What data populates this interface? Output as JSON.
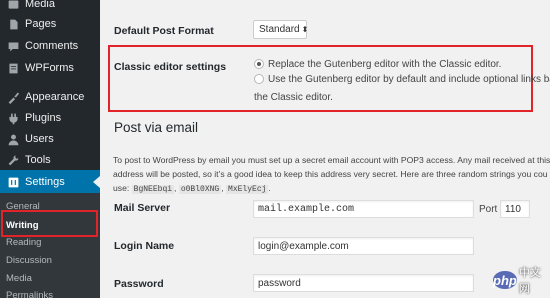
{
  "sidebar": {
    "items": [
      {
        "label": "Media",
        "icon": "media-icon"
      },
      {
        "label": "Pages",
        "icon": "pages-icon"
      },
      {
        "label": "Comments",
        "icon": "comments-icon"
      },
      {
        "label": "WPForms",
        "icon": "wpforms-icon"
      },
      {
        "label": "Appearance",
        "icon": "appearance-icon"
      },
      {
        "label": "Plugins",
        "icon": "plugins-icon"
      },
      {
        "label": "Users",
        "icon": "users-icon"
      },
      {
        "label": "Tools",
        "icon": "tools-icon"
      },
      {
        "label": "Settings",
        "icon": "settings-icon"
      }
    ],
    "submenu": [
      "General",
      "Writing",
      "Reading",
      "Discussion",
      "Media",
      "Permalinks"
    ]
  },
  "writing": {
    "default_post_format_label": "Default Post Format",
    "default_post_format_value": "Standard",
    "classic_editor_label": "Classic editor settings",
    "classic_option_1": "Replace the Gutenberg editor with the Classic editor.",
    "classic_option_2_line1": "Use the Gutenberg editor by default and include optional links back to",
    "classic_option_2_line2": "the Classic editor."
  },
  "post_via_email": {
    "heading": "Post via email",
    "desc_line1": "To post to WordPress by email you must set up a secret email account with POP3 access. Any mail received at this",
    "desc_line2": "address will be posted, so it’s a good idea to keep this address very secret. Here are three random strings you cou",
    "desc_use": "use:",
    "codes": [
      "BgNEEbqi",
      "o0Bl0XNG",
      "MxElyEcj"
    ],
    "mail_server_label": "Mail Server",
    "mail_server_value": "mail.example.com",
    "port_label": "Port",
    "port_value": "110",
    "login_name_label": "Login Name",
    "login_name_value": "login@example.com",
    "password_label": "Password",
    "password_value": "password"
  },
  "watermark": {
    "php": "php",
    "cn": "中文网"
  },
  "colors": {
    "sidebar_bg": "#23282d",
    "accent": "#0073aa",
    "highlight": "#e1232a"
  }
}
